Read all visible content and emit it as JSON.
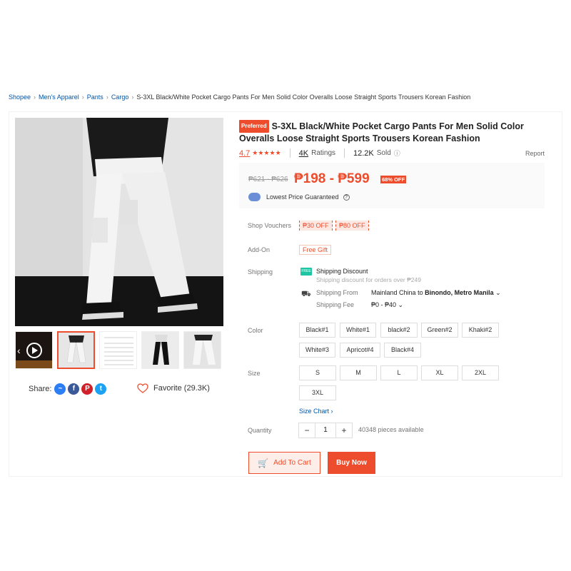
{
  "breadcrumb": {
    "items": [
      "Shopee",
      "Men's Apparel",
      "Pants",
      "Cargo"
    ],
    "current": "S-3XL Black/White Pocket Cargo Pants For Men Solid Color Overalls Loose Straight Sports Trousers Korean Fashion"
  },
  "product": {
    "badge": "Preferred",
    "title": "S-3XL Black/White Pocket Cargo Pants For Men Solid Color Overalls Loose Straight Sports Trousers Korean Fashion",
    "rating": "4.7",
    "stars": "★★★★★",
    "ratings_count": "4K",
    "ratings_label": "Ratings",
    "sold_count": "12.2K",
    "sold_label": "Sold",
    "report": "Report"
  },
  "price": {
    "original": "₱621 - ₱626",
    "current": "₱198 - ₱599",
    "discount": "68% OFF",
    "lowest_label": "Lowest Price Guaranteed"
  },
  "vouchers": {
    "label": "Shop Vouchers",
    "items": [
      "₱30 OFF",
      "₱80 OFF"
    ]
  },
  "addon": {
    "label": "Add-On",
    "value": "Free Gift"
  },
  "shipping": {
    "label": "Shipping",
    "discount_title": "Shipping Discount",
    "discount_sub": "Shipping discount for orders over ₱249",
    "from_label": "Shipping From",
    "from_origin": "Mainland China",
    "from_to": "to",
    "from_dest": "Binondo, Metro Manila",
    "fee_label": "Shipping Fee",
    "fee_value": "₱0 - ₱40"
  },
  "color": {
    "label": "Color",
    "options": [
      "Black#1",
      "White#1",
      "black#2",
      "Green#2",
      "Khaki#2",
      "White#3",
      "Apricot#4",
      "Black#4"
    ]
  },
  "size": {
    "label": "Size",
    "options": [
      "S",
      "M",
      "L",
      "XL",
      "2XL",
      "3XL"
    ],
    "chart_link": "Size Chart"
  },
  "quantity": {
    "label": "Quantity",
    "minus": "−",
    "value": "1",
    "plus": "+",
    "available": "40348 pieces available"
  },
  "actions": {
    "add_to_cart": "Add To Cart",
    "buy_now": "Buy Now"
  },
  "share": {
    "label": "Share:",
    "favorite": "Favorite (29.3K)",
    "icons": [
      "messenger-icon",
      "facebook-icon",
      "pinterest-icon",
      "twitter-icon"
    ]
  },
  "colors": {
    "accent": "#ee4d2d",
    "link": "#0055aa"
  }
}
